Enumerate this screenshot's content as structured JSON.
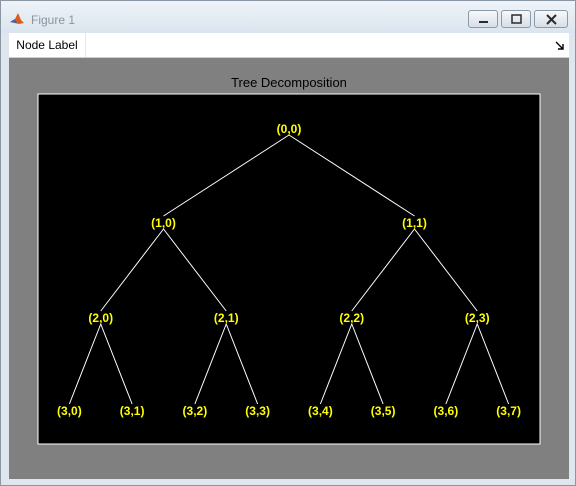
{
  "window": {
    "title": "Figure 1"
  },
  "toolbar": {
    "node_label_menu": "Node Label"
  },
  "plot": {
    "title": "Tree Decomposition"
  },
  "colors": {
    "axes_bg": "#000000",
    "edge": "#ffffff",
    "label": "#ffff00",
    "figure_bg": "#808080"
  },
  "chart_data": {
    "type": "tree",
    "title": "Tree Decomposition",
    "nodes": [
      {
        "label": "(0,0)",
        "depth": 0,
        "index": 0
      },
      {
        "label": "(1,0)",
        "depth": 1,
        "index": 0
      },
      {
        "label": "(1,1)",
        "depth": 1,
        "index": 1
      },
      {
        "label": "(2,0)",
        "depth": 2,
        "index": 0
      },
      {
        "label": "(2,1)",
        "depth": 2,
        "index": 1
      },
      {
        "label": "(2,2)",
        "depth": 2,
        "index": 2
      },
      {
        "label": "(2,3)",
        "depth": 2,
        "index": 3
      },
      {
        "label": "(3,0)",
        "depth": 3,
        "index": 0
      },
      {
        "label": "(3,1)",
        "depth": 3,
        "index": 1
      },
      {
        "label": "(3,2)",
        "depth": 3,
        "index": 2
      },
      {
        "label": "(3,3)",
        "depth": 3,
        "index": 3
      },
      {
        "label": "(3,4)",
        "depth": 3,
        "index": 4
      },
      {
        "label": "(3,5)",
        "depth": 3,
        "index": 5
      },
      {
        "label": "(3,6)",
        "depth": 3,
        "index": 6
      },
      {
        "label": "(3,7)",
        "depth": 3,
        "index": 7
      }
    ],
    "edges": [
      [
        "(0,0)",
        "(1,0)"
      ],
      [
        "(0,0)",
        "(1,1)"
      ],
      [
        "(1,0)",
        "(2,0)"
      ],
      [
        "(1,0)",
        "(2,1)"
      ],
      [
        "(1,1)",
        "(2,2)"
      ],
      [
        "(1,1)",
        "(2,3)"
      ],
      [
        "(2,0)",
        "(3,0)"
      ],
      [
        "(2,0)",
        "(3,1)"
      ],
      [
        "(2,1)",
        "(3,2)"
      ],
      [
        "(2,1)",
        "(3,3)"
      ],
      [
        "(2,2)",
        "(3,4)"
      ],
      [
        "(2,2)",
        "(3,5)"
      ],
      [
        "(2,3)",
        "(3,6)"
      ],
      [
        "(2,3)",
        "(3,7)"
      ]
    ]
  }
}
